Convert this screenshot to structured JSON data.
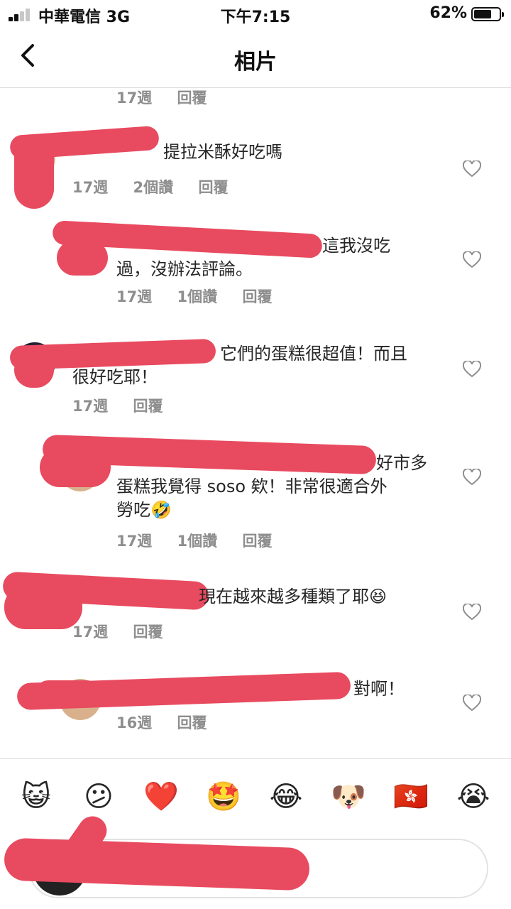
{
  "status_bar": {
    "carrier": "中華電信  3G",
    "time": "下午7:15",
    "battery": "62%"
  },
  "nav": {
    "title": "相片",
    "back_icon": "chevron-left-icon"
  },
  "comments": [
    {
      "text": "",
      "week": "17週",
      "likes": "",
      "reply": "回覆"
    },
    {
      "text": "提拉米酥好吃嗎",
      "week": "17週",
      "likes": "2個讚",
      "reply": "回覆"
    },
    {
      "text": "這我沒吃\n過，沒辦法評論。",
      "week": "17週",
      "likes": "1個讚",
      "reply": "回覆"
    },
    {
      "text": "它們的蛋糕很超值！而且\n很好吃耶！",
      "week": "17週",
      "likes": "",
      "reply": "回覆"
    },
    {
      "text": "好市多\n蛋糕我覺得 soso 欸！非常很適合外\n勞吃🤣",
      "week": "17週",
      "likes": "1個讚",
      "reply": "回覆"
    },
    {
      "text": "現在越來越多種類了耶😆",
      "week": "17週",
      "likes": "",
      "reply": "回覆"
    },
    {
      "text": "對啊！",
      "week": "16週",
      "likes": "",
      "reply": "回覆"
    }
  ],
  "emoji_bar": [
    "😺",
    "😕",
    "❤️",
    "🤩",
    "😂",
    "🐶",
    "🇭🇰",
    "😭"
  ],
  "comment_input": {
    "placeholder": ""
  },
  "colors": {
    "redaction": "#e84a5f",
    "meta": "#8e8e8e"
  }
}
